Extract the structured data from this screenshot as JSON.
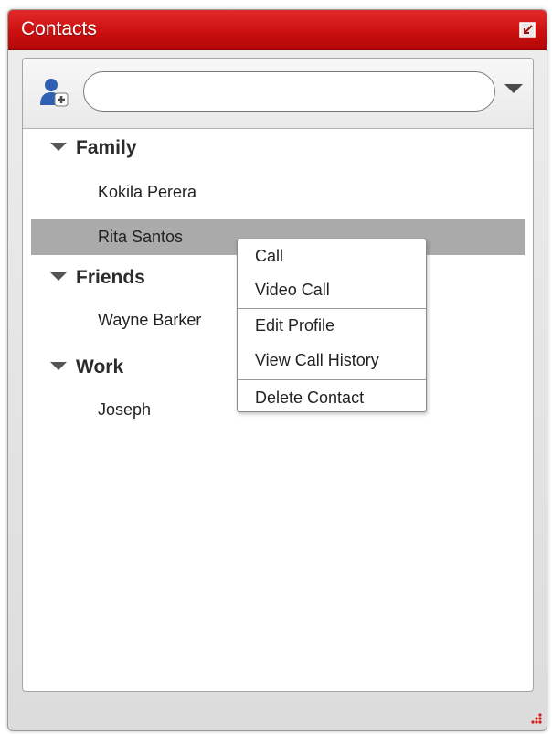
{
  "window": {
    "title": "Contacts"
  },
  "toolbar": {
    "search_value": "",
    "search_placeholder": ""
  },
  "groups": [
    {
      "name": "Family",
      "contacts": [
        "Kokila Perera",
        "Rita Santos"
      ]
    },
    {
      "name": "Friends",
      "contacts": [
        "Wayne Barker"
      ]
    },
    {
      "name": "Work",
      "contacts": [
        "Joseph"
      ]
    }
  ],
  "selected_contact": "Rita Santos",
  "context_menu": {
    "items": [
      "Call",
      "Video Call",
      "Edit Profile",
      "View Call History",
      "Delete Contact"
    ]
  },
  "colors": {
    "titlebar": "#cc1010",
    "selection": "#aaaaaa"
  },
  "icons": {
    "add_contact": "add-contact-icon",
    "popout": "popout-icon",
    "dropdown": "dropdown-arrow-icon",
    "expand": "expand-triangle-icon",
    "resize": "resize-grip-icon"
  }
}
